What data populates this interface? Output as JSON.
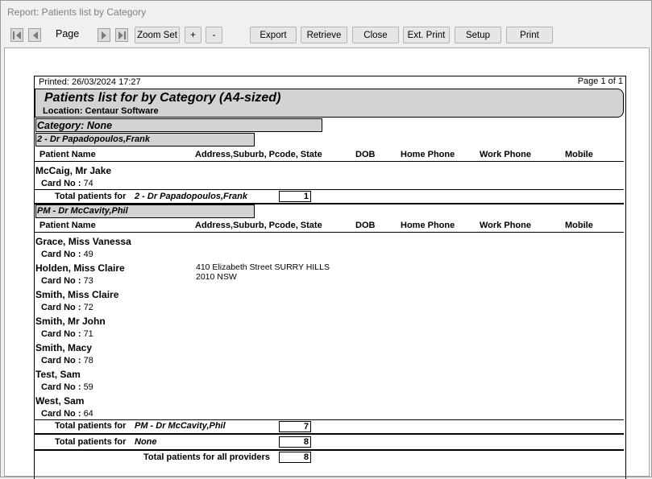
{
  "window": {
    "title": "Report: Patients list by Category"
  },
  "toolbar": {
    "page_label": "Page",
    "zoom_set": "Zoom Set",
    "zoom_in": "+",
    "zoom_out": "-",
    "export": "Export",
    "retrieve": "Retrieve",
    "close": "Close",
    "ext_print": "Ext. Print",
    "setup": "Setup",
    "print": "Print"
  },
  "report": {
    "printed": "Printed: 26/03/2024 17:27",
    "page": "Page 1 of 1",
    "title": "Patients list for by Category  (A4-sized)",
    "location": "Location: Centaur Software",
    "category": "Category: None",
    "columns": {
      "name": "Patient Name",
      "address": "Address,Suburb, Pcode, State",
      "dob": "DOB",
      "home": "Home Phone",
      "work": "Work Phone",
      "mobile": "Mobile"
    },
    "card_label": "Card No :",
    "group1": {
      "provider": "2 -  Dr Papadopoulos,Frank",
      "patients": [
        {
          "name": "McCaig, Mr Jake",
          "card": "74"
        }
      ],
      "total_label": "Total patients for",
      "total_name": "2 -  Dr Papadopoulos,Frank",
      "total": "1"
    },
    "group2": {
      "provider": "PM -  Dr McCavity,Phil",
      "patients": [
        {
          "name": "Grace, Miss Vanessa",
          "card": "49"
        },
        {
          "name": "Holden, Miss Claire",
          "card": "73",
          "address1": "410 Elizabeth Street SURRY HILLS",
          "address2": "2010  NSW"
        },
        {
          "name": "Smith, Miss Claire",
          "card": "72"
        },
        {
          "name": "Smith, Mr John",
          "card": "71"
        },
        {
          "name": "Smith,  Macy",
          "card": "78"
        },
        {
          "name": "Test,  Sam",
          "card": "59"
        },
        {
          "name": "West,  Sam",
          "card": "64"
        }
      ],
      "total_label": "Total patients for",
      "total_name": "PM -  Dr McCavity,Phil",
      "total": "7"
    },
    "category_total_label": "Total patients for",
    "category_total_name": "None",
    "category_total": "8",
    "all_total_label": "Total patients for all providers",
    "all_total": "8"
  }
}
